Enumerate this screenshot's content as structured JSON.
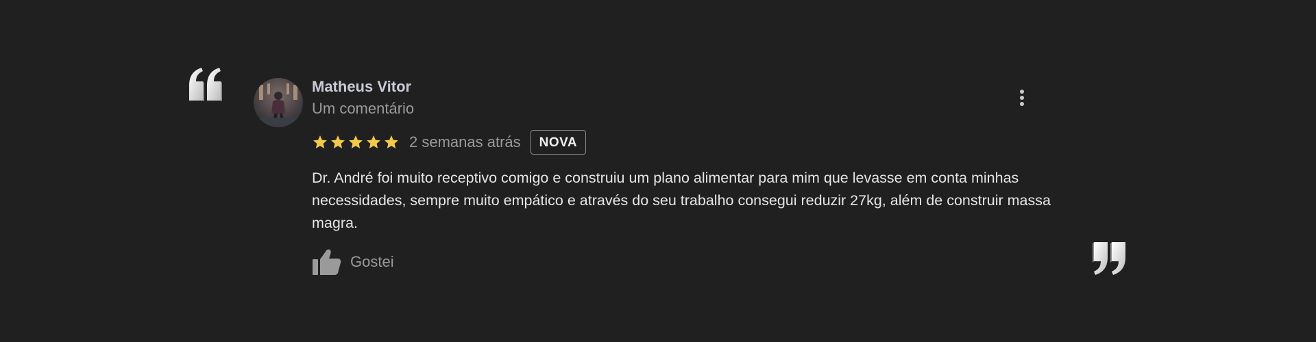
{
  "review": {
    "author_name": "Matheus Vitor",
    "author_meta": "Um comentário",
    "rating": 5,
    "rating_max": 5,
    "time_ago": "2 semanas atrás",
    "badge": "NOVA",
    "text": "Dr. André foi muito receptivo comigo e construiu um plano alimentar para mim que levasse em conta minhas necessidades, sempre muito empático e através do seu trabalho consegui reduzir 27kg, além de construir massa magra.",
    "like_label": "Gostei"
  },
  "colors": {
    "background": "#202020",
    "star": "#f2c94c",
    "name": "#c9cbd6",
    "muted": "#9a9a9a",
    "text": "#e6e6e6"
  },
  "icons": {
    "open_quote": "quote-open-icon",
    "close_quote": "quote-close-icon",
    "star": "star-icon",
    "thumbs_up": "thumbs-up-icon",
    "more": "more-vertical-icon"
  }
}
